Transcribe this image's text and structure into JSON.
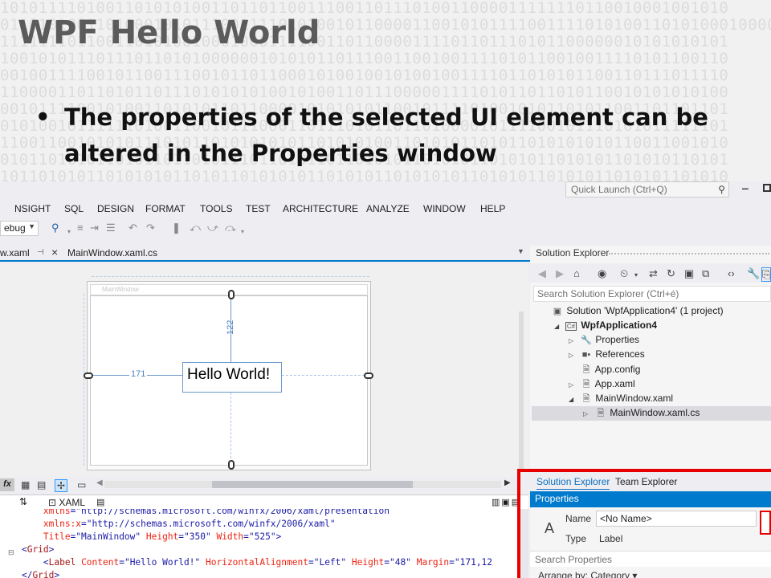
{
  "slide": {
    "binary_lines": [
      "1010111101001101010100110110110011100110111010011000011111110110010001001010",
      "0110101001101000101011100111101010010110000110010101111001111010100110101000100001000000001110",
      "1111111011001101010010001000111100110110000111101101110101100000010101010101",
      "1001010111011101101010000001010101101110011001001111010110010011110101100110",
      "0010011110010110011100101101100010100100101001001111011010101100110111011110",
      "1100001101101011011101010101001010011011100000111101011011010110010101010100",
      "0010111100101001101010110110000101010101100101111010010101101011001101101101",
      "0101001011111101001100101110001101110101101101000010111100101110101011111101",
      "1100110010101011101011010101010110101010011010101101011010101010110011001010",
      "0101101010110101101101011101101011011010101101010110101011010101101010110101",
      "1011010101101010101101011010101011010101101010101101010110101011010101101010"
    ],
    "title": "WPF Hello World",
    "bullet_marker": "•",
    "bullet": "The properties of the selected UI element can be altered in the Properties window"
  },
  "ide": {
    "quick_launch_placeholder": "Quick Launch (Ctrl+Q)",
    "menu": [
      "NSIGHT",
      "SQL",
      "DESIGN",
      "FORMAT",
      "TOOLS",
      "TEST",
      "ARCHITECTURE",
      "ANALYZE",
      "WINDOW",
      "HELP"
    ],
    "config_combo": "ebug",
    "tabs": {
      "inactive": "w.xaml",
      "active": "MainWindow.xaml.cs"
    },
    "designer": {
      "window_title": "MainWindow",
      "label_text": "Hello World!",
      "margin_top": "122",
      "margin_left": "171"
    },
    "xaml_tab_label": "XAML",
    "xaml_lines": [
      {
        "indent": "        ",
        "parts": [
          {
            "t": "xmlns",
            "c": "attr"
          },
          {
            "t": "=\"http://schemas.microsoft.com/winfx/2006/xaml/presentation",
            "c": "str"
          }
        ]
      },
      {
        "indent": "        ",
        "parts": [
          {
            "t": "xmlns:x",
            "c": "attr"
          },
          {
            "t": "=\"http://schemas.microsoft.com/winfx/2006/xaml\"",
            "c": "str"
          }
        ]
      },
      {
        "indent": "        ",
        "parts": [
          {
            "t": "Title",
            "c": "attr"
          },
          {
            "t": "=\"MainWindow\" ",
            "c": "str"
          },
          {
            "t": "Height",
            "c": "attr"
          },
          {
            "t": "=\"350\" ",
            "c": "str"
          },
          {
            "t": "Width",
            "c": "attr"
          },
          {
            "t": "=\"525\">",
            "c": "str"
          }
        ]
      },
      {
        "indent": "    ",
        "parts": [
          {
            "t": "<",
            "c": "pun"
          },
          {
            "t": "Grid",
            "c": "tag"
          },
          {
            "t": ">",
            "c": "pun"
          }
        ]
      },
      {
        "indent": "        ",
        "parts": [
          {
            "t": "<",
            "c": "pun"
          },
          {
            "t": "Label ",
            "c": "tag"
          },
          {
            "t": "Content",
            "c": "attr"
          },
          {
            "t": "=\"Hello World!\" ",
            "c": "str"
          },
          {
            "t": "HorizontalAlignment",
            "c": "attr"
          },
          {
            "t": "=\"Left\" ",
            "c": "str"
          },
          {
            "t": "Height",
            "c": "attr"
          },
          {
            "t": "=\"48\" ",
            "c": "str"
          },
          {
            "t": "Margin",
            "c": "attr"
          },
          {
            "t": "=\"171,12",
            "c": "str"
          }
        ]
      },
      {
        "indent": "    ",
        "parts": [
          {
            "t": "</",
            "c": "pun"
          },
          {
            "t": "Grid",
            "c": "tag"
          },
          {
            "t": ">",
            "c": "pun"
          }
        ]
      }
    ],
    "solution_explorer": {
      "title": "Solution Explorer",
      "search_placeholder": "Search Solution Explorer (Ctrl+é)",
      "items": [
        {
          "label": "Solution 'WpfApplication4' (1 project)",
          "icon": "solution-icon",
          "glyph": "▣",
          "indent": 0,
          "toggle": "",
          "bold": false
        },
        {
          "label": "WpfApplication4",
          "icon": "csharp-project-icon",
          "glyph": "C#",
          "indent": 1,
          "toggle": "◢",
          "bold": true
        },
        {
          "label": "Properties",
          "icon": "wrench-icon",
          "glyph": "🔧",
          "indent": 2,
          "toggle": "▷",
          "bold": false
        },
        {
          "label": "References",
          "icon": "references-icon",
          "glyph": "■▪",
          "indent": 2,
          "toggle": "▷",
          "bold": false
        },
        {
          "label": "App.config",
          "icon": "config-file-icon",
          "glyph": "🗎",
          "indent": 2,
          "toggle": "",
          "bold": false
        },
        {
          "label": "App.xaml",
          "icon": "xaml-file-icon",
          "glyph": "🗎",
          "indent": 2,
          "toggle": "▷",
          "bold": false
        },
        {
          "label": "MainWindow.xaml",
          "icon": "xaml-file-icon",
          "glyph": "🗎",
          "indent": 2,
          "toggle": "◢",
          "bold": false
        },
        {
          "label": "MainWindow.xaml.cs",
          "icon": "cs-file-icon",
          "glyph": "🗎",
          "indent": 3,
          "toggle": "▷",
          "bold": false,
          "selected": true
        }
      ]
    },
    "properties": {
      "tab_solution_explorer": "Solution Explorer",
      "tab_team_explorer": "Team Explorer",
      "header": "Properties",
      "name_label": "Name",
      "name_value": "<No Name>",
      "type_label": "Type",
      "type_value": "Label",
      "type_glyph": "A",
      "search_placeholder": "Search Properties",
      "arrange_by": "Arrange by: Category ▾"
    },
    "colors": {
      "accent": "#007acc",
      "highlight_frame": "#e60000",
      "selection": "#cce4f7"
    }
  }
}
